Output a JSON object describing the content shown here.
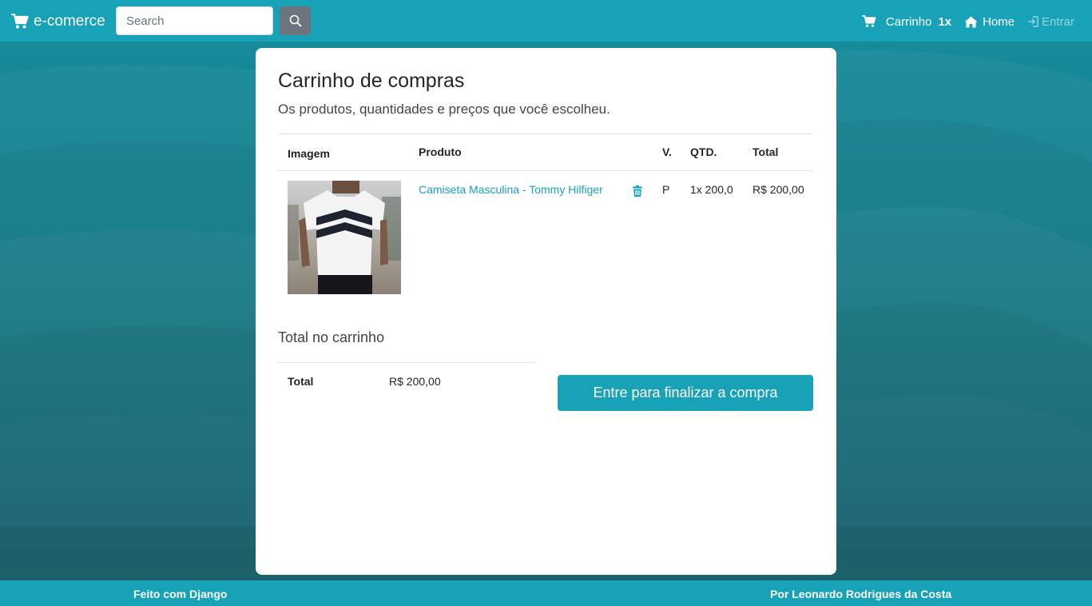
{
  "navbar": {
    "brand": "e-comerce",
    "search_placeholder": "Search",
    "cart_label": "Carrinho",
    "cart_count": "1x",
    "home_label": "Home",
    "login_label": "Entrar"
  },
  "cart": {
    "title": "Carrinho de compras",
    "subtitle": "Os produtos, quantidades e preços que você escolheu.",
    "columns": {
      "image": "Imagem",
      "product": "Produto",
      "variation": "V.",
      "quantity": "QTD.",
      "total": "Total"
    },
    "items": [
      {
        "name": "Camiseta Masculina - Tommy Hilfiger",
        "variation": "P",
        "quantity": "1x 200,0",
        "total": "R$ 200,00"
      }
    ],
    "summary": {
      "heading": "Total no carrinho",
      "label": "Total",
      "value": "R$ 200,00"
    },
    "checkout_button": "Entre para finalizar a compra"
  },
  "footer": {
    "left": "Feito com Django",
    "right": "Por Leonardo Rodrigues da Costa"
  },
  "colors": {
    "primary": "#17a2b8",
    "secondary": "#6c757d",
    "background": "#147c8a"
  },
  "icons": [
    "shopping-cart-icon",
    "search-icon",
    "home-icon",
    "sign-in-icon",
    "trash-icon"
  ]
}
